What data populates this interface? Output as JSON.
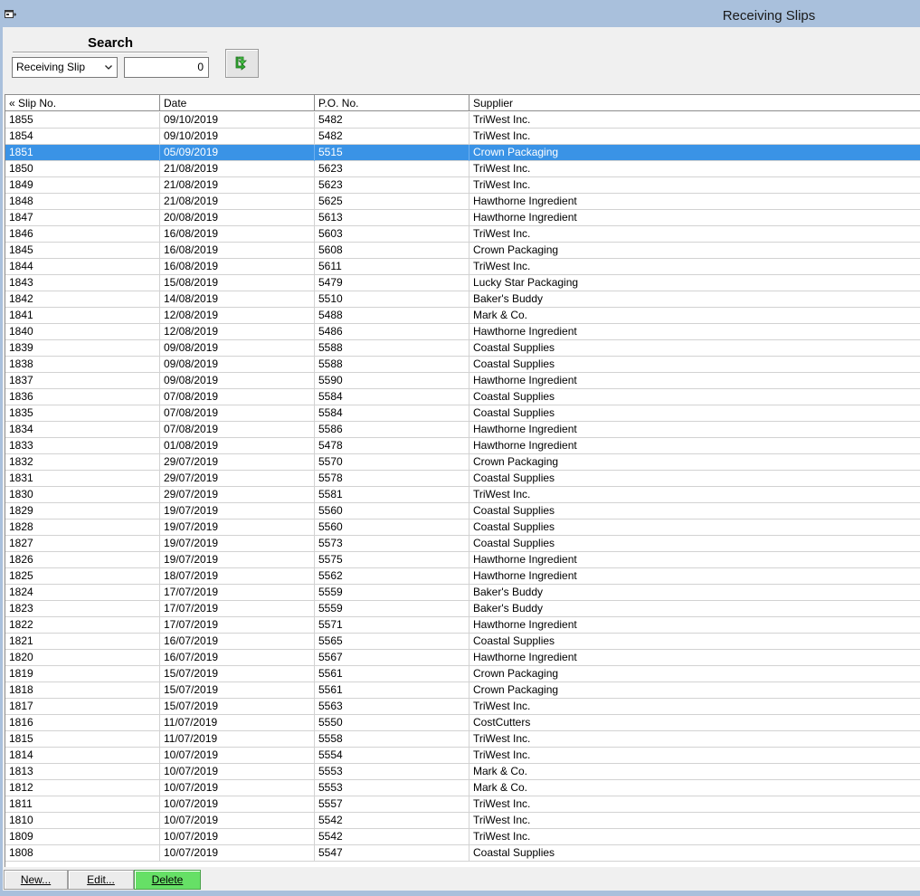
{
  "window": {
    "title": "Receiving Slips",
    "icon": "form-window-icon"
  },
  "search": {
    "label": "Search",
    "field_selected": "Receiving Slip",
    "value": "0",
    "go_icon": "green-return-arrow-icon"
  },
  "grid": {
    "columns": [
      "« Slip No.",
      "Date",
      "P.O. No.",
      "Supplier"
    ],
    "selected_slip": "1851",
    "rows": [
      {
        "slip": "1855",
        "date": "09/10/2019",
        "po": "5482",
        "supplier": "TriWest Inc."
      },
      {
        "slip": "1854",
        "date": "09/10/2019",
        "po": "5482",
        "supplier": "TriWest Inc."
      },
      {
        "slip": "1851",
        "date": "05/09/2019",
        "po": "5515",
        "supplier": "Crown Packaging"
      },
      {
        "slip": "1850",
        "date": "21/08/2019",
        "po": "5623",
        "supplier": "TriWest Inc."
      },
      {
        "slip": "1849",
        "date": "21/08/2019",
        "po": "5623",
        "supplier": "TriWest Inc."
      },
      {
        "slip": "1848",
        "date": "21/08/2019",
        "po": "5625",
        "supplier": "Hawthorne Ingredient"
      },
      {
        "slip": "1847",
        "date": "20/08/2019",
        "po": "5613",
        "supplier": "Hawthorne Ingredient"
      },
      {
        "slip": "1846",
        "date": "16/08/2019",
        "po": "5603",
        "supplier": "TriWest Inc."
      },
      {
        "slip": "1845",
        "date": "16/08/2019",
        "po": "5608",
        "supplier": "Crown Packaging"
      },
      {
        "slip": "1844",
        "date": "16/08/2019",
        "po": "5611",
        "supplier": "TriWest Inc."
      },
      {
        "slip": "1843",
        "date": "15/08/2019",
        "po": "5479",
        "supplier": "Lucky Star Packaging"
      },
      {
        "slip": "1842",
        "date": "14/08/2019",
        "po": "5510",
        "supplier": "Baker's Buddy"
      },
      {
        "slip": "1841",
        "date": "12/08/2019",
        "po": "5488",
        "supplier": "Mark & Co."
      },
      {
        "slip": "1840",
        "date": "12/08/2019",
        "po": "5486",
        "supplier": "Hawthorne Ingredient"
      },
      {
        "slip": "1839",
        "date": "09/08/2019",
        "po": "5588",
        "supplier": "Coastal Supplies"
      },
      {
        "slip": "1838",
        "date": "09/08/2019",
        "po": "5588",
        "supplier": "Coastal Supplies"
      },
      {
        "slip": "1837",
        "date": "09/08/2019",
        "po": "5590",
        "supplier": "Hawthorne Ingredient"
      },
      {
        "slip": "1836",
        "date": "07/08/2019",
        "po": "5584",
        "supplier": "Coastal Supplies"
      },
      {
        "slip": "1835",
        "date": "07/08/2019",
        "po": "5584",
        "supplier": "Coastal Supplies"
      },
      {
        "slip": "1834",
        "date": "07/08/2019",
        "po": "5586",
        "supplier": "Hawthorne Ingredient"
      },
      {
        "slip": "1833",
        "date": "01/08/2019",
        "po": "5478",
        "supplier": "Hawthorne Ingredient"
      },
      {
        "slip": "1832",
        "date": "29/07/2019",
        "po": "5570",
        "supplier": "Crown Packaging"
      },
      {
        "slip": "1831",
        "date": "29/07/2019",
        "po": "5578",
        "supplier": "Coastal Supplies"
      },
      {
        "slip": "1830",
        "date": "29/07/2019",
        "po": "5581",
        "supplier": "TriWest Inc."
      },
      {
        "slip": "1829",
        "date": "19/07/2019",
        "po": "5560",
        "supplier": "Coastal Supplies"
      },
      {
        "slip": "1828",
        "date": "19/07/2019",
        "po": "5560",
        "supplier": "Coastal Supplies"
      },
      {
        "slip": "1827",
        "date": "19/07/2019",
        "po": "5573",
        "supplier": "Coastal Supplies"
      },
      {
        "slip": "1826",
        "date": "19/07/2019",
        "po": "5575",
        "supplier": "Hawthorne Ingredient"
      },
      {
        "slip": "1825",
        "date": "18/07/2019",
        "po": "5562",
        "supplier": "Hawthorne Ingredient"
      },
      {
        "slip": "1824",
        "date": "17/07/2019",
        "po": "5559",
        "supplier": "Baker's Buddy"
      },
      {
        "slip": "1823",
        "date": "17/07/2019",
        "po": "5559",
        "supplier": "Baker's Buddy"
      },
      {
        "slip": "1822",
        "date": "17/07/2019",
        "po": "5571",
        "supplier": "Hawthorne Ingredient"
      },
      {
        "slip": "1821",
        "date": "16/07/2019",
        "po": "5565",
        "supplier": "Coastal Supplies"
      },
      {
        "slip": "1820",
        "date": "16/07/2019",
        "po": "5567",
        "supplier": "Hawthorne Ingredient"
      },
      {
        "slip": "1819",
        "date": "15/07/2019",
        "po": "5561",
        "supplier": "Crown Packaging"
      },
      {
        "slip": "1818",
        "date": "15/07/2019",
        "po": "5561",
        "supplier": "Crown Packaging"
      },
      {
        "slip": "1817",
        "date": "15/07/2019",
        "po": "5563",
        "supplier": "TriWest Inc."
      },
      {
        "slip": "1816",
        "date": "11/07/2019",
        "po": "5550",
        "supplier": "CostCutters"
      },
      {
        "slip": "1815",
        "date": "11/07/2019",
        "po": "5558",
        "supplier": "TriWest Inc."
      },
      {
        "slip": "1814",
        "date": "10/07/2019",
        "po": "5554",
        "supplier": "TriWest Inc."
      },
      {
        "slip": "1813",
        "date": "10/07/2019",
        "po": "5553",
        "supplier": "Mark & Co."
      },
      {
        "slip": "1812",
        "date": "10/07/2019",
        "po": "5553",
        "supplier": "Mark & Co."
      },
      {
        "slip": "1811",
        "date": "10/07/2019",
        "po": "5557",
        "supplier": "TriWest Inc."
      },
      {
        "slip": "1810",
        "date": "10/07/2019",
        "po": "5542",
        "supplier": "TriWest Inc."
      },
      {
        "slip": "1809",
        "date": "10/07/2019",
        "po": "5542",
        "supplier": "TriWest Inc."
      },
      {
        "slip": "1808",
        "date": "10/07/2019",
        "po": "5547",
        "supplier": "Coastal Supplies"
      }
    ]
  },
  "buttons": {
    "new": "New...",
    "edit": "Edit...",
    "delete": "Delete"
  },
  "colors": {
    "chrome": "#a9c0dc",
    "selection": "#3a93e6",
    "delete_button": "#66e066"
  }
}
